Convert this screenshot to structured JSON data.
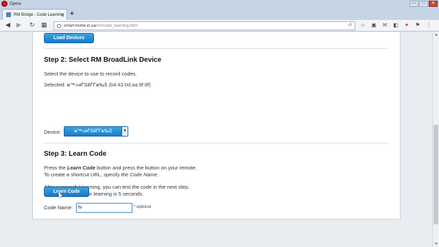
{
  "titlebar": {
    "app_name": "Opera",
    "minimize": "—",
    "maximize": "□",
    "close": "✕"
  },
  "tab": {
    "title": "RM Bridge - Code Learning",
    "close": "×",
    "new_tab": "+"
  },
  "toolbar": {
    "url_host": "smart-home.in.ua",
    "url_path": "/rm/code_learning.html",
    "url_badge": "-A"
  },
  "page": {
    "load_devices_button": "Load Devices",
    "step2": {
      "heading": "Step 2: Select RM BroadLink Device",
      "instruction": "Select the device to use to record codes.",
      "selected_label": "Selected:",
      "selected_name": "ж™«иЃЅйЃЃж‰§",
      "selected_mac": "(b4:43:0d:aa:9f:8f)",
      "device_label": "Device:",
      "device_value": "ж™«иЃЅйЃЃж‰§"
    },
    "step3": {
      "heading": "Step 3: Learn Code",
      "line1_pre": "Press the ",
      "line1_em": "Learn Code",
      "line1_post": " button and press the button on your remote.",
      "line2_pre": "To create a shortcut URL, specify the ",
      "line2_em": "Code Name",
      "line2_post": ".",
      "line3": "After successful learning, you can test the code in the next step.",
      "line4": "Note: The timeout for learning is 5 seconds.",
      "code_name_label": "Code Name:",
      "code_name_value": "tv",
      "optional_note": "* optional",
      "learn_code_button": "Learn Code"
    }
  }
}
